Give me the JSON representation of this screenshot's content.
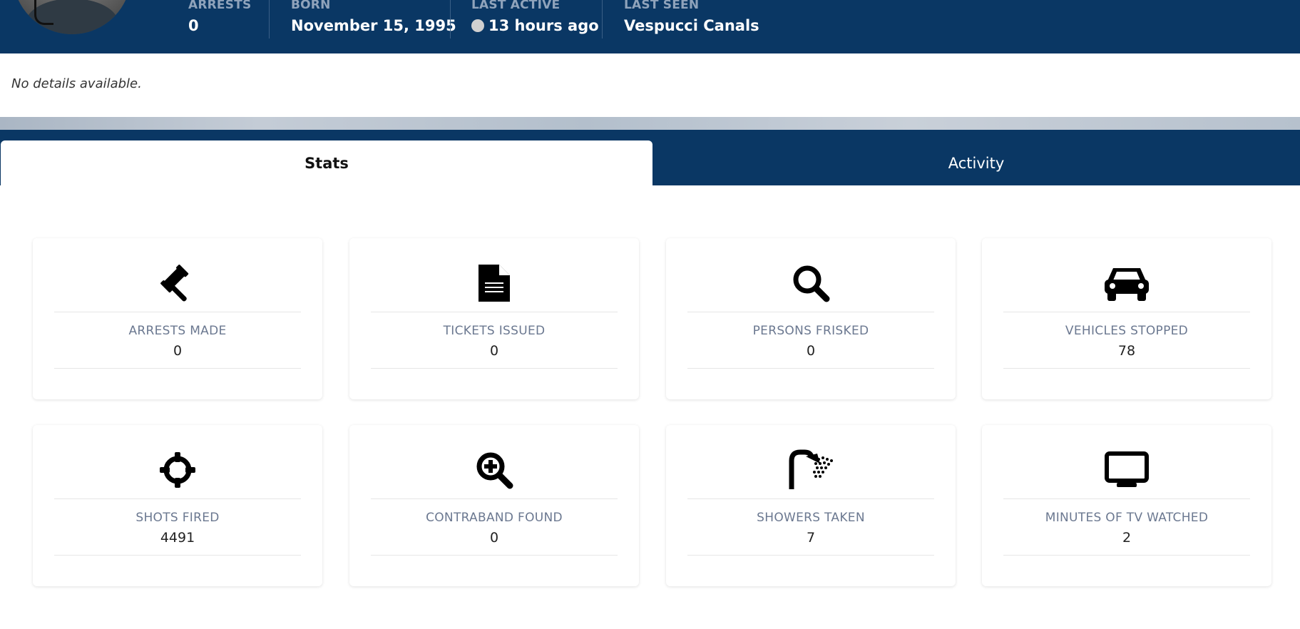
{
  "profile": {
    "stats": [
      {
        "label": "ARRESTS",
        "value": "0"
      },
      {
        "label": "BORN",
        "value": "November 15, 1995"
      },
      {
        "label": "LAST ACTIVE",
        "value": "13 hours ago"
      },
      {
        "label": "LAST SEEN",
        "value": "Vespucci Canals"
      }
    ],
    "details": "No details available."
  },
  "tabs": [
    {
      "label": "Stats",
      "active": true
    },
    {
      "label": "Activity",
      "active": false
    }
  ],
  "cards": [
    {
      "icon": "gavel-icon",
      "label": "ARRESTS MADE",
      "value": "0"
    },
    {
      "icon": "document-icon",
      "label": "TICKETS ISSUED",
      "value": "0"
    },
    {
      "icon": "search-icon",
      "label": "PERSONS FRISKED",
      "value": "0"
    },
    {
      "icon": "car-icon",
      "label": "VEHICLES STOPPED",
      "value": "78"
    },
    {
      "icon": "crosshair-icon",
      "label": "SHOTS FIRED",
      "value": "4491"
    },
    {
      "icon": "search-plus-icon",
      "label": "CONTRABAND FOUND",
      "value": "0"
    },
    {
      "icon": "shower-icon",
      "label": "SHOWERS TAKEN",
      "value": "7"
    },
    {
      "icon": "tv-icon",
      "label": "MINUTES OF TV WATCHED",
      "value": "2"
    }
  ],
  "colors": {
    "header_bg": "#0a3764",
    "status_dot": "#d0d0d0"
  }
}
